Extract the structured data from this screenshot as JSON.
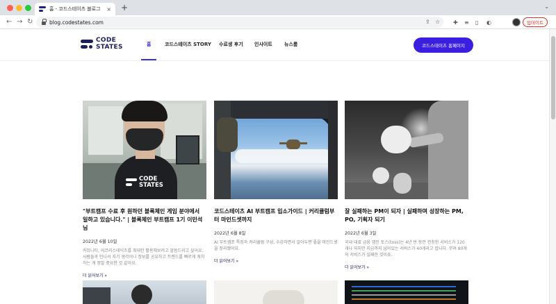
{
  "browser": {
    "tab_title": "홈 - 코드스테이츠 블로그",
    "tab_close": "×",
    "new_tab": "+",
    "tab_menu": "⌄",
    "back": "←",
    "forward": "→",
    "reload": "↻",
    "url": "blog.codestates.com",
    "update_label": "업데이트",
    "menu_dots": "⋮"
  },
  "site": {
    "logo_line1": "CODE",
    "logo_line2": "STATES",
    "nav": [
      {
        "label": "홈",
        "active": true
      },
      {
        "label": "코드스테이츠 STORY"
      },
      {
        "label": "수료생 후기"
      },
      {
        "label": "인사이트"
      },
      {
        "label": "뉴스룸"
      }
    ],
    "cta_label": "코드스테이츠 홈페이지",
    "accent_color": "#3b1fe0",
    "brand_color": "#1a1f5c"
  },
  "posts": [
    {
      "title": "\"부트캠프 수료 후 원하던 블록체인 게임 분야에서 일하고 있습니다.\" | 블록체인 부트캠프 1기 이민석님",
      "date": "2022년 6월 10일",
      "excerpt": "커뮤니티, 어코리스테이츠를 최대한 활용해보려고 말씀드리고 싶어요. 사람들과 만나서 자기 생각이나 정보를 공유하고 트렌드를 빠르게 캐치하는 게 정말 중요한 것 같아요.",
      "more": "더 읽어보기 »",
      "image_logo_line1": "CODE",
      "image_logo_line2": "STATES"
    },
    {
      "title": "코드스테이츠 AI 부트캠프 입소가이드 | 커리큘럼부터 마인드셋까지",
      "date": "2022년 6월 8일",
      "excerpt": "AI 부트캠프 특징과 커리큘럼 구성, 수강하면서 알아두면 좋을 마인드셋을 정리했어요.",
      "more": "더 읽어보기 »"
    },
    {
      "title": "잘 실패하는 PM이 되자 | 실패하며 성장하는 PM, PO, 기획자 되기",
      "date": "2022년 6월 3일",
      "excerpt": "국내 대표 금융 앱인 토스(toss)는 4년 반 동안 런칭한 서비스가 120개나 되지만 지금까지 남아있는 서비스가 40개라고 합니다. 무려 80개의 서비스가 실패한 것이죠.",
      "more": "더 읽어보기 »"
    }
  ]
}
